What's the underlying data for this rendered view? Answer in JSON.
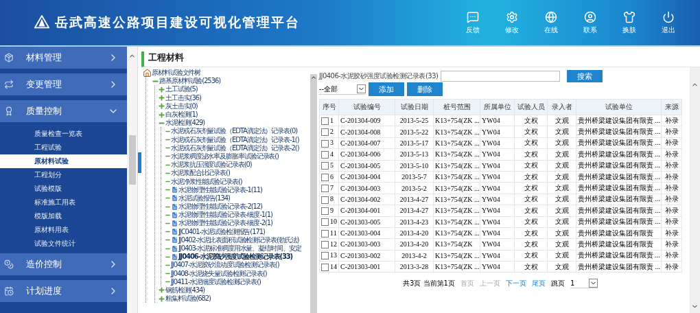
{
  "header": {
    "title": "岳武高速公路项目建设可视化管理平台",
    "actions": [
      {
        "kind": "feedback",
        "label": "反馈"
      },
      {
        "kind": "settings",
        "label": "修改"
      },
      {
        "kind": "online",
        "label": "在线"
      },
      {
        "kind": "contact",
        "label": "联系"
      },
      {
        "kind": "skin",
        "label": "换肤"
      },
      {
        "kind": "logout",
        "label": "退出"
      }
    ]
  },
  "sidebar": {
    "groups": [
      {
        "kind": "materials",
        "label": "材料管理",
        "expanded": false
      },
      {
        "kind": "changes",
        "label": "变更管理",
        "expanded": false
      },
      {
        "kind": "quality",
        "label": "质量控制",
        "expanded": true,
        "items": [
          {
            "label": "质量检查一览表",
            "selected": false
          },
          {
            "label": "工程试验",
            "selected": false
          },
          {
            "label": "原材料试验",
            "selected": true
          },
          {
            "label": "工程划分",
            "selected": false
          },
          {
            "label": "试验模版",
            "selected": false
          },
          {
            "label": "标准施工用表",
            "selected": false
          },
          {
            "label": "模版加载",
            "selected": false
          },
          {
            "label": "原材料用表",
            "selected": false
          },
          {
            "label": "试验文件统计",
            "selected": false
          }
        ]
      },
      {
        "kind": "cost",
        "label": "造价控制",
        "expanded": false
      },
      {
        "kind": "plan",
        "label": "计划进度",
        "expanded": false
      }
    ]
  },
  "page_title": "工程材料",
  "tree": {
    "kind": "root",
    "label": "原材料试验文件树",
    "selected": false,
    "children": [
      {
        "kind": "folder",
        "label": "路基原材料试验(2536)",
        "expanded": true,
        "selected": false,
        "children": [
          {
            "kind": "folder",
            "label": "土工试验(5)",
            "expanded": false,
            "selected": false
          },
          {
            "kind": "folder",
            "label": "土工击实(36)",
            "expanded": false,
            "selected": false
          },
          {
            "kind": "folder",
            "label": "灰土击实(0)",
            "expanded": false,
            "selected": false
          },
          {
            "kind": "folder",
            "label": "白灰检测(1)",
            "expanded": false,
            "selected": false
          },
          {
            "kind": "folder",
            "label": "水泥检测(429)",
            "expanded": true,
            "selected": false,
            "children": [
              {
                "kind": "leaf",
                "label": "水泥或石灰剂量试验（EDTA滴定法）记录表(0)",
                "selected": false
              },
              {
                "kind": "leaf",
                "label": "水泥或石灰剂量试验（EDTA滴定法）记录表-1()",
                "selected": false
              },
              {
                "kind": "leaf",
                "label": "水泥或石灰剂量试验（EDTA滴定法）记录表-2()",
                "selected": false
              },
              {
                "kind": "leaf",
                "label": "水泥浆稠度泌水率及膨胀率试验记录表()",
                "selected": false
              },
              {
                "kind": "leaf",
                "label": "水泥浆抗压强度试验记录表(0)",
                "selected": false
              },
              {
                "kind": "leaf",
                "label": "水泥浆配合比记录表()",
                "selected": false
              },
              {
                "kind": "leaf",
                "label": "水泥净浆性能试验记录表()",
                "selected": false
              },
              {
                "kind": "doc",
                "label": "水泥物理性能试验记录表-1(11)",
                "selected": false
              },
              {
                "kind": "doc",
                "label": "水泥试验报告(134)",
                "selected": false
              },
              {
                "kind": "doc",
                "label": "水泥物理性能试验记录表-2(12)",
                "selected": false
              },
              {
                "kind": "doc",
                "label": "水泥物理性能试验记录表-细度-1(1)",
                "selected": false
              },
              {
                "kind": "doc",
                "label": "水泥物理性能试验记录表-细度-2(1)",
                "selected": false
              },
              {
                "kind": "doc",
                "label": "JJC0401-水泥试验检测报告(171)",
                "selected": false
              },
              {
                "kind": "doc",
                "label": "JJ0402-水泥比表面积试验检测记录表(勃氏法)",
                "selected": false
              },
              {
                "kind": "doc",
                "label": "JJ0403-水泥标准稠度用水量、凝结时间、安定",
                "selected": false
              },
              {
                "kind": "doc",
                "label": "JJ0406-水泥胶砂强度试验检测记录表(33)",
                "selected": true
              },
              {
                "kind": "leaf",
                "label": "JJ0407-水泥胶砂流动度试验检测记录表()",
                "selected": false
              },
              {
                "kind": "leaf",
                "label": "JJ0408-水泥烧失量试验检测记录表()",
                "selected": false
              },
              {
                "kind": "leaf",
                "label": "JJ0411-水泥细度试验检测记录表()",
                "selected": false
              }
            ]
          },
          {
            "kind": "folder",
            "label": "钢筋检测(434)",
            "expanded": false,
            "selected": false
          },
          {
            "kind": "folder",
            "label": "粗集料试验(682)",
            "expanded": false,
            "selected": false
          }
        ]
      }
    ]
  },
  "toolbar": {
    "form_label": "JJ0406-水泥胶砂强度试验检测记录表(33)",
    "search_button": "搜索",
    "filter_value": "--全部",
    "buttons": [
      "添加",
      "删除"
    ]
  },
  "table": {
    "columns": [
      "序号",
      "试验编号",
      "试验日期",
      "桩号范围",
      "所属单位",
      "试验人员",
      "录入者",
      "试验单位",
      "来源"
    ],
    "rows": [
      {
        "checked": false,
        "cells": [
          "1",
          "C-201304-009",
          "2013-5-25",
          "K13+754(ZK ...",
          "YW04",
          "文权",
          "文观",
          "贵州桥梁建设集团有限责 ...",
          "补录"
        ]
      },
      {
        "checked": false,
        "cells": [
          "2",
          "C-201304-008",
          "2013-5-22",
          "K13+754(ZK ...",
          "YW04",
          "文权",
          "文观",
          "贵州桥梁建设集团有限责 ...",
          "补录"
        ]
      },
      {
        "checked": false,
        "cells": [
          "3",
          "C-201304-007",
          "2013-5-17",
          "K13+754(ZK ...",
          "YW04",
          "文权",
          "文观",
          "贵州桥梁建设集团有限责 ...",
          "补录"
        ]
      },
      {
        "checked": false,
        "cells": [
          "4",
          "C-201304-006",
          "2013-5-13",
          "K13+754(ZK ...",
          "YW04",
          "文权",
          "文观",
          "贵州桥梁建设集团有限责 ...",
          "补录"
        ]
      },
      {
        "checked": false,
        "cells": [
          "5",
          "C-201304-005",
          "2013-5-10",
          "K13+754(ZK ...",
          "YW04",
          "文权",
          "文观",
          "贵州桥梁建设集团有限责 ...",
          "补录"
        ]
      },
      {
        "checked": false,
        "cells": [
          "6",
          "C-201304-004",
          "2013-5-7",
          "K13+754(ZK ...",
          "YW04",
          "文权",
          "文观",
          "贵州桥梁建设集团有限责 ...",
          "补录"
        ]
      },
      {
        "checked": false,
        "cells": [
          "7",
          "C-201304-003",
          "2013-5-2",
          "K13+754(ZK ...",
          "YW04",
          "文权",
          "文观",
          "贵州桥梁建设集团有限责 ...",
          "补录"
        ]
      },
      {
        "checked": false,
        "cells": [
          "8",
          "C-201304-002",
          "2013-4-27",
          "K13+754(ZK ...",
          "YW04",
          "文权",
          "文观",
          "贵州桥梁建设集团有限责 ...",
          "补录"
        ]
      },
      {
        "checked": false,
        "cells": [
          "9",
          "C-201304-001",
          "2013-4-27",
          "K13+754(ZK ...",
          "YW04",
          "文权",
          "文观",
          "贵州桥梁建设集团有限责 ...",
          "补录"
        ]
      },
      {
        "checked": false,
        "cells": [
          "10",
          "C-201303-005",
          "2013-4-23",
          "K13+754(ZK ...",
          "YW04",
          "文权",
          "文观",
          "贵州桥梁建设集团有限责 ...",
          "补录"
        ]
      },
      {
        "checked": false,
        "cells": [
          "11",
          "C-201303-004",
          "2013-4-20",
          "K13+754(ZK ...",
          "YW04",
          "文权",
          "文观",
          "贵州桥梁建设集团有限责",
          "补录"
        ]
      },
      {
        "checked": false,
        "cells": [
          "12",
          "C-201303-003",
          "2013-4-20",
          "K13+754(ZK",
          "YW04",
          "文权",
          "文观",
          "贵州桥梁建设集团有限责",
          "补录"
        ]
      },
      {
        "checked": false,
        "cells": [
          "13",
          "C-201303-002",
          "2013-4-2",
          "K13+754(ZK ...",
          "YW04",
          "文权",
          "文观",
          "贵州桥梁建设集团有限责 ...",
          "补录"
        ]
      },
      {
        "checked": false,
        "cells": [
          "14",
          "C-201303-001",
          "2013-3-28",
          "K13+754(ZK ...",
          "YW04",
          "文权",
          "文观",
          "贵州桥梁建设集团有限责 ...",
          "补录"
        ]
      }
    ]
  },
  "pagination": {
    "summary": "共3页 当前第1页",
    "links": [
      {
        "label": "首页",
        "disabled": true
      },
      {
        "label": "上一页",
        "disabled": true
      },
      {
        "label": "下一页",
        "disabled": false
      },
      {
        "label": "尾页",
        "disabled": false
      }
    ],
    "jump_label": "跳页",
    "jump_value": "1"
  }
}
